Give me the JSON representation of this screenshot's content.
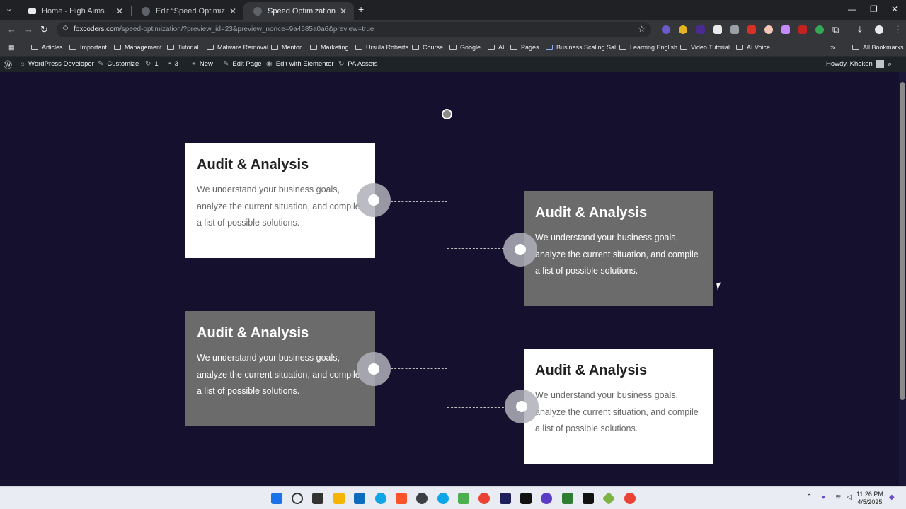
{
  "browser": {
    "tabs": [
      {
        "title": "Home - High Aims",
        "favicon_color": "#e8eaed"
      },
      {
        "title": "Edit “Speed Optimization” with",
        "favicon_color": "#5f6368"
      },
      {
        "title": "Speed Optimization – WordPre",
        "favicon_color": "#5f6368"
      }
    ],
    "new_tab_label": "+",
    "url_host": "foxcoders.com",
    "url_path": "/speed-optimization/?preview_id=23&preview_nonce=9a4585a0a6&preview=true"
  },
  "bookmarks": {
    "items": [
      "Articles",
      "Important",
      "Management",
      "Tutorial",
      "Malware Removal",
      "Mentor",
      "Marketing",
      "Ursula Roberts",
      "Course",
      "Google",
      "AI",
      "Pages",
      "Business Scaling Sal...",
      "Learning English",
      "Video Tutorial",
      "AI Voice"
    ],
    "more_label": "»",
    "all_bookmarks": "All Bookmarks"
  },
  "adminbar": {
    "site_name": "WordPress Developer",
    "customize": "Customize",
    "updates_count": "1",
    "comments_count": "3",
    "new_label": "New",
    "edit_page": "Edit Page",
    "edit_elementor": "Edit with Elementor",
    "pa_assets": "PA Assets",
    "howdy": "Howdy, Khokon"
  },
  "timeline": {
    "cards": [
      {
        "title": "Audit & Analysis",
        "text": "We understand your business goals, analyze the current situation, and compile a list of possible solutions.",
        "style": "white"
      },
      {
        "title": "Audit & Analysis",
        "text": "We understand your business goals, analyze the current situation, and compile a list of possible solutions.",
        "style": "gray"
      },
      {
        "title": "Audit & Analysis",
        "text": "We understand your business goals, analyze the current situation, and compile a list of possible solutions.",
        "style": "gray"
      },
      {
        "title": "Audit & Analysis",
        "text": "We understand your business goals, analyze the current situation, and compile a list of possible solutions.",
        "style": "white"
      }
    ]
  },
  "taskbar": {
    "time": "11:26 PM",
    "date": "4/5/2025"
  },
  "colors": {
    "page_bg": "#14102e",
    "card_gray": "#6b6b6b",
    "card_white": "#ffffff",
    "admin_bar": "#1d2327"
  }
}
